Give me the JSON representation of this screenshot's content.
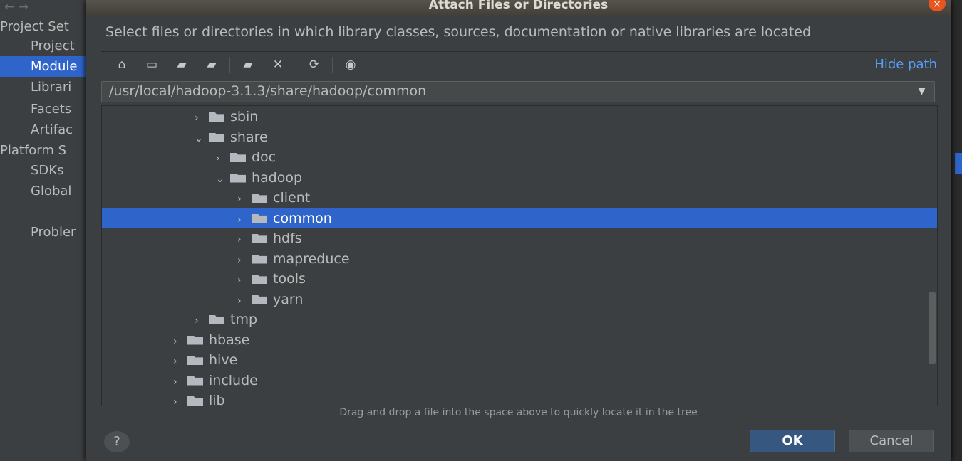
{
  "background": {
    "nav_arrows": "← →",
    "sidebar": [
      {
        "label": "Project Set",
        "indent": 0
      },
      {
        "label": "Project",
        "indent": 1
      },
      {
        "label": "Module",
        "indent": 1,
        "selected": true
      },
      {
        "label": "Librari",
        "indent": 1
      },
      {
        "label": "Facets",
        "indent": 1
      },
      {
        "label": "Artifac",
        "indent": 1
      },
      {
        "label": "Platform S",
        "indent": 0
      },
      {
        "label": "SDKs",
        "indent": 1
      },
      {
        "label": "Global",
        "indent": 1
      },
      {
        "label": "Probler",
        "indent": 1
      }
    ]
  },
  "dialog": {
    "title": "Attach Files or Directories",
    "close_icon": "×",
    "description": "Select files or directories in which library classes, sources, documentation or native libraries are located",
    "toolbar": [
      {
        "name": "home-icon",
        "glyph": "⌂"
      },
      {
        "name": "desktop-icon",
        "glyph": "▭"
      },
      {
        "name": "project-folder-icon",
        "glyph": "▰"
      },
      {
        "name": "module-folder-icon",
        "glyph": "▰"
      },
      {
        "name": "new-folder-icon",
        "glyph": "▰"
      },
      {
        "name": "delete-icon",
        "glyph": "✕"
      },
      {
        "name": "refresh-icon",
        "glyph": "⟳"
      },
      {
        "name": "show-hidden-icon",
        "glyph": "◉"
      }
    ],
    "hide_path": "Hide path",
    "path": "/usr/local/hadoop-3.1.3/share/hadoop/common",
    "tree": [
      {
        "label": "sbin",
        "level": 1,
        "expanded": false
      },
      {
        "label": "share",
        "level": 1,
        "expanded": true
      },
      {
        "label": "doc",
        "level": 2,
        "expanded": false
      },
      {
        "label": "hadoop",
        "level": 2,
        "expanded": true
      },
      {
        "label": "client",
        "level": 3,
        "expanded": false
      },
      {
        "label": "common",
        "level": 3,
        "expanded": false,
        "selected": true
      },
      {
        "label": "hdfs",
        "level": 3,
        "expanded": false
      },
      {
        "label": "mapreduce",
        "level": 3,
        "expanded": false
      },
      {
        "label": "tools",
        "level": 3,
        "expanded": false
      },
      {
        "label": "yarn",
        "level": 3,
        "expanded": false
      },
      {
        "label": "tmp",
        "level": 1,
        "expanded": false
      },
      {
        "label": "hbase",
        "level": 0,
        "expanded": false
      },
      {
        "label": "hive",
        "level": 0,
        "expanded": false
      },
      {
        "label": "include",
        "level": 0,
        "expanded": false
      },
      {
        "label": "lib",
        "level": 0,
        "expanded": false
      }
    ],
    "hint": "Drag and drop a file into the space above to quickly locate it in the tree",
    "help": "?",
    "ok": "OK",
    "cancel": "Cancel",
    "colors": {
      "selection": "#2f65ca",
      "link": "#589df6",
      "close": "#e95420"
    }
  }
}
